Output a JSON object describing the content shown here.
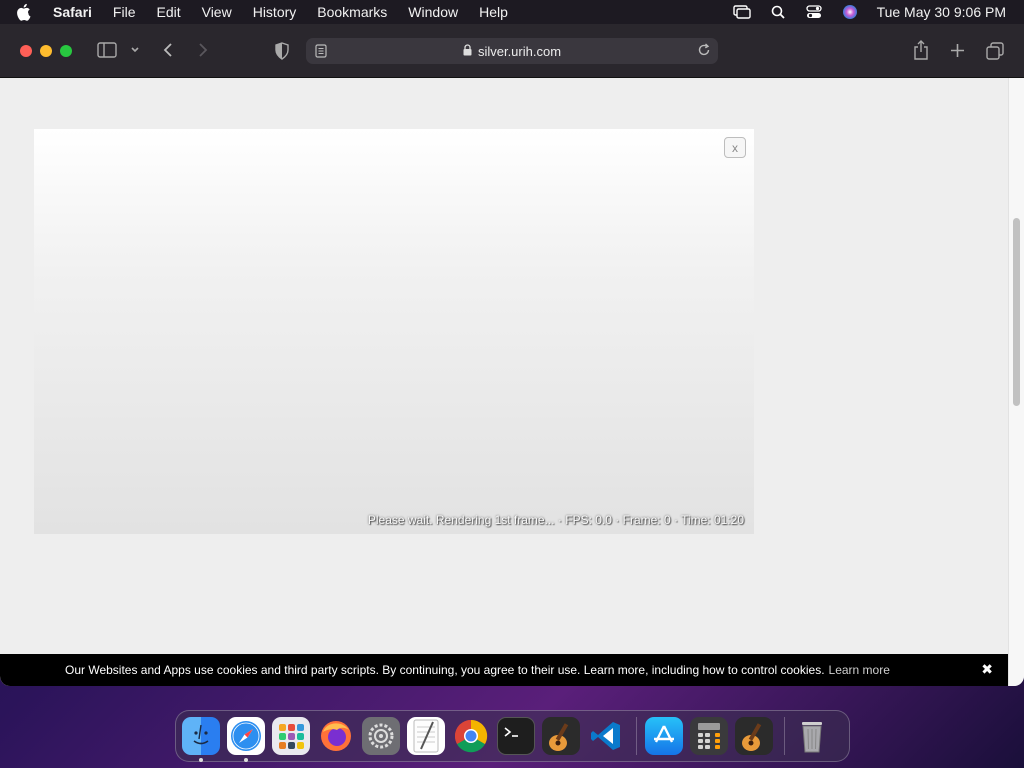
{
  "menubar": {
    "app_name": "Safari",
    "items": [
      "File",
      "Edit",
      "View",
      "History",
      "Bookmarks",
      "Window",
      "Help"
    ],
    "clock": "Tue May 30  9:06 PM"
  },
  "browser": {
    "url": "silver.urih.com"
  },
  "player": {
    "close_label": "x",
    "status": "Please wait. Rendering 1st frame... · FPS: 0.0 · Frame: 0 · Time: 01:20"
  },
  "cookie_bar": {
    "text": "Our Websites and Apps use cookies and third party scripts. By continuing, you agree to their use. Learn more, including how to control cookies.",
    "link": "Learn more",
    "close": "✖"
  },
  "dock": {
    "apps": [
      "finder-icon",
      "safari-icon",
      "launchpad-icon",
      "firefox-icon",
      "system-settings-icon",
      "textedit-icon",
      "chrome-icon",
      "terminal-icon",
      "garageband-icon",
      "vscode-icon",
      "app-store-icon",
      "calculator-icon",
      "garageband-2-icon",
      "trash-icon"
    ]
  }
}
